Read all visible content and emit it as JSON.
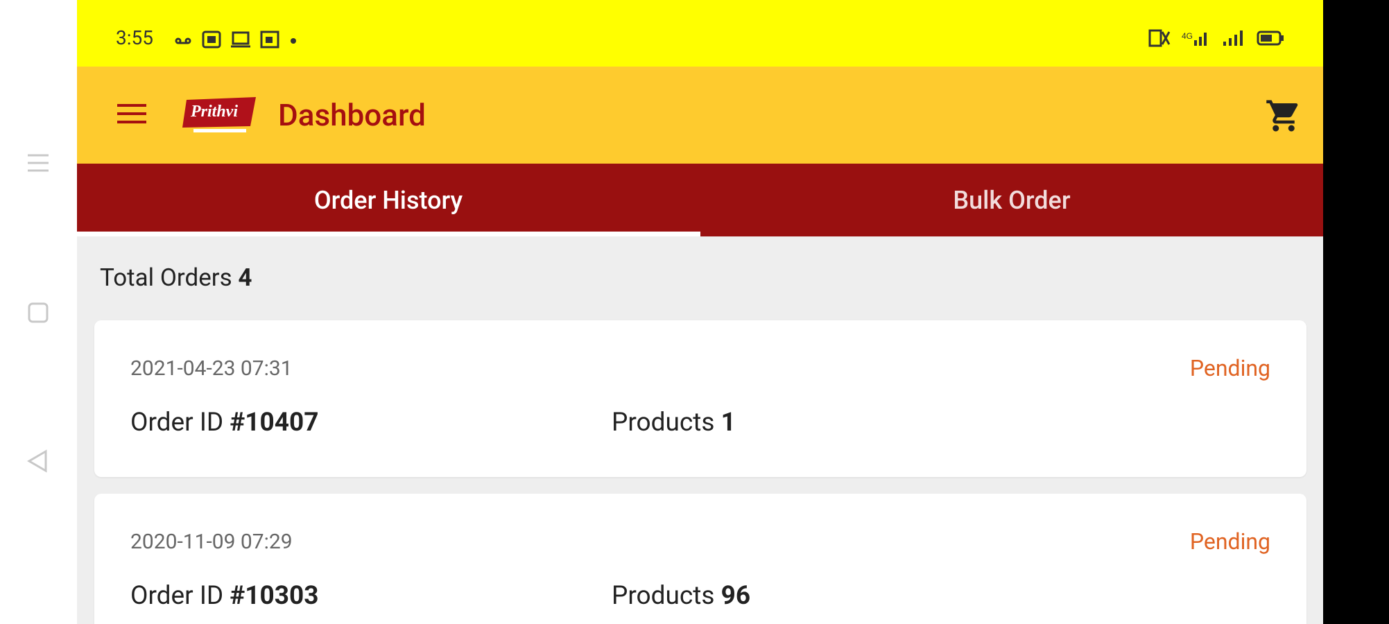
{
  "system_nav": {
    "menu_icon": "menu-icon",
    "home_icon": "square-home-icon",
    "back_icon": "triangle-back-icon"
  },
  "status_bar": {
    "time": "3:55",
    "left_icons": [
      "voicemail-icon",
      "photo-icon",
      "screen-icon",
      "gallery-icon",
      "dot-icon"
    ],
    "right_icons": [
      "no-sim-icon",
      "signal-icon",
      "signal-icon",
      "battery-icon"
    ]
  },
  "app_bar": {
    "title": "Dashboard",
    "logo_text": "Prithvi",
    "menu_icon": "hamburger-icon",
    "cart_icon": "cart-icon"
  },
  "tabs": [
    {
      "label": "Order History",
      "active": true
    },
    {
      "label": "Bulk Order",
      "active": false
    }
  ],
  "summary": {
    "total_label": "Total Orders",
    "total_value": "4"
  },
  "orders": [
    {
      "date": "2021-04-23 07:31",
      "status": "Pending",
      "order_label": "Order ID",
      "order_id": "#10407",
      "products_label": "Products",
      "products_count": "1"
    },
    {
      "date": "2020-11-09 07:29",
      "status": "Pending",
      "order_label": "Order ID",
      "order_id": "#10303",
      "products_label": "Products",
      "products_count": "96"
    }
  ],
  "colors": {
    "status_bar": "#ffff00",
    "app_bar": "#fecb2e",
    "tab_bar": "#991010",
    "title_text": "#a50f10",
    "pending": "#e06322",
    "background": "#eeeeee"
  }
}
